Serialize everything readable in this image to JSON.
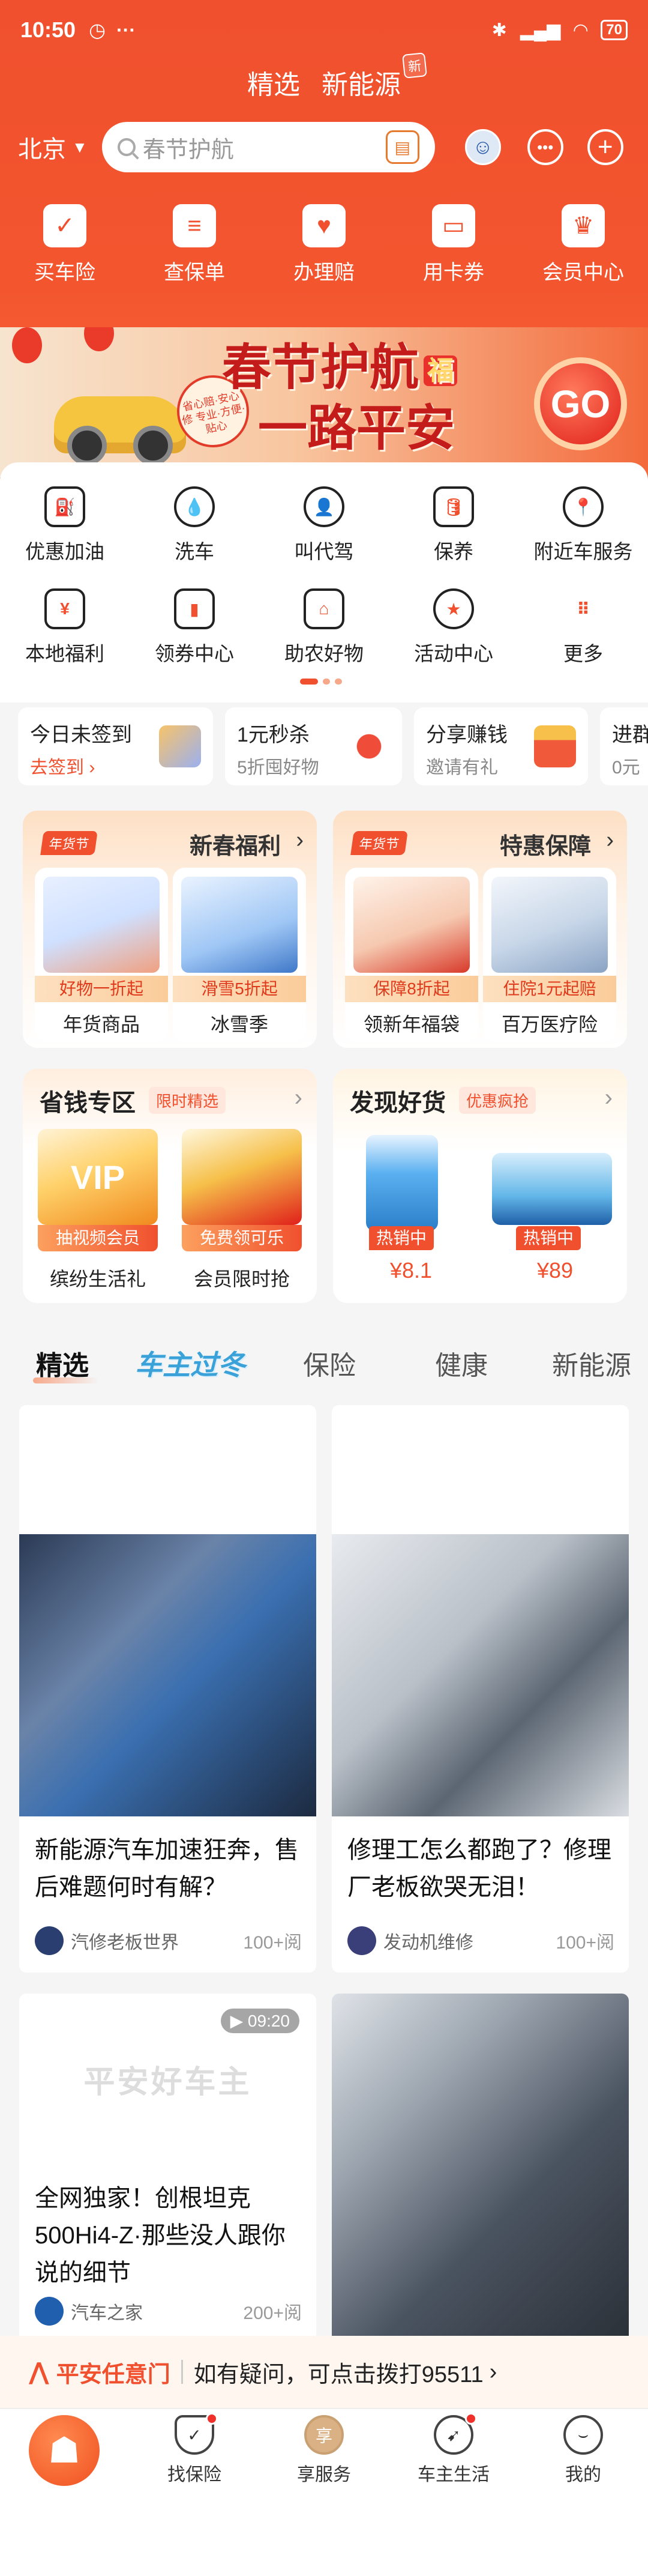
{
  "status_bar": {
    "time": "10:50",
    "battery": "70"
  },
  "top_tabs": [
    {
      "label": "精选"
    },
    {
      "label": "新能源",
      "badge": "新"
    }
  ],
  "search": {
    "city": "北京",
    "placeholder": "春节护航"
  },
  "quick_actions": [
    {
      "label": "买车险",
      "icon": "shield-check-icon"
    },
    {
      "label": "查保单",
      "icon": "document-icon"
    },
    {
      "label": "办理赔",
      "icon": "hand-heart-icon"
    },
    {
      "label": "用卡券",
      "icon": "ticket-icon"
    },
    {
      "label": "会员中心",
      "icon": "crown-icon"
    }
  ],
  "banner": {
    "line1": "春节护航",
    "line2": "一路平安",
    "badge": "福",
    "seal_text": "省心赔·安心修 专业·方便·贴心",
    "cta": "GO"
  },
  "services_row1": [
    {
      "label": "优惠加油",
      "icon": "fuel-icon",
      "glyph": "⛽"
    },
    {
      "label": "洗车",
      "icon": "car-wash-icon",
      "glyph": "💧"
    },
    {
      "label": "叫代驾",
      "icon": "driver-icon",
      "glyph": "👤"
    },
    {
      "label": "保养",
      "icon": "oil-bottle-icon",
      "glyph": "🛢"
    },
    {
      "label": "附近车服务",
      "icon": "location-pin-icon",
      "glyph": "📍"
    }
  ],
  "services_row2": [
    {
      "label": "本地福利",
      "icon": "local-benefit-icon",
      "glyph": "¥"
    },
    {
      "label": "领券中心",
      "icon": "coupon-wallet-icon",
      "glyph": "▮"
    },
    {
      "label": "助农好物",
      "icon": "farm-house-icon",
      "glyph": "⌂"
    },
    {
      "label": "活动中心",
      "icon": "star-circle-icon",
      "glyph": "★"
    },
    {
      "label": "更多",
      "icon": "grid-more-icon",
      "glyph": "⠿"
    }
  ],
  "promo_strip": [
    {
      "title": "今日未签到",
      "sub": "去签到",
      "sub_is_link": true
    },
    {
      "title": "1元秒杀",
      "sub": "5折囤好物"
    },
    {
      "title": "分享赚钱",
      "sub": "邀请有礼"
    },
    {
      "title": "进群",
      "sub": "0元"
    }
  ],
  "new_year_card": {
    "badge": "年货节",
    "title": "新春福利",
    "items": [
      {
        "ribbon": "好物一折起",
        "label": "年货商品"
      },
      {
        "ribbon": "滑雪5折起",
        "label": "冰雪季"
      }
    ]
  },
  "protection_card": {
    "badge": "年货节",
    "title": "特惠保障",
    "items": [
      {
        "ribbon": "保障8折起",
        "label": "领新年福袋"
      },
      {
        "ribbon": "住院1元起赔",
        "label": "百万医疗险"
      }
    ]
  },
  "savings_card": {
    "title": "省钱专区",
    "tag": "限时精选",
    "items": [
      {
        "pill": "抽视频会员",
        "label": "缤纷生活礼",
        "img_text": "VIP"
      },
      {
        "pill": "免费领可乐",
        "label": "会员限时抢"
      }
    ]
  },
  "goods_card": {
    "title": "发现好货",
    "tag": "优惠疯抢",
    "items": [
      {
        "hot": "热销中",
        "price": "¥8.1"
      },
      {
        "hot": "热销中",
        "price": "¥89"
      }
    ]
  },
  "content_tabs": [
    {
      "label": "精选",
      "active": true
    },
    {
      "label": "车主过冬",
      "special": true
    },
    {
      "label": "保险"
    },
    {
      "label": "健康"
    },
    {
      "label": "新能源"
    }
  ],
  "articles": [
    {
      "title": "新能源汽车加速狂奔，售后难题何时有解？",
      "author": "汽修老板世界",
      "views": "100+阅"
    },
    {
      "title": "修理工怎么都跑了？修理厂老板欲哭无泪！",
      "author": "发动机维修",
      "views": "100+阅"
    },
    {
      "title": "全网独家！创根坦克500Hi4-Z·那些没人跟你说的细节",
      "author": "汽车之家",
      "views": "200+阅",
      "duration": "09:20",
      "watermark": "平安好车主"
    },
    {
      "title": "",
      "author": "",
      "views": ""
    }
  ],
  "hint_bar": {
    "brand": "平安任意门",
    "text": "如有疑问，可点击拨打95511"
  },
  "bottom_nav": [
    {
      "label": "",
      "icon": "home-logo-icon"
    },
    {
      "label": "找保险",
      "icon": "shield-icon",
      "dot": true
    },
    {
      "label": "享服务",
      "icon": "service-icon"
    },
    {
      "label": "车主生活",
      "icon": "compass-icon",
      "dot": true
    },
    {
      "label": "我的",
      "icon": "profile-face-icon"
    }
  ],
  "colors": {
    "brand": "#f0502e",
    "background": "#f5f5f5"
  }
}
